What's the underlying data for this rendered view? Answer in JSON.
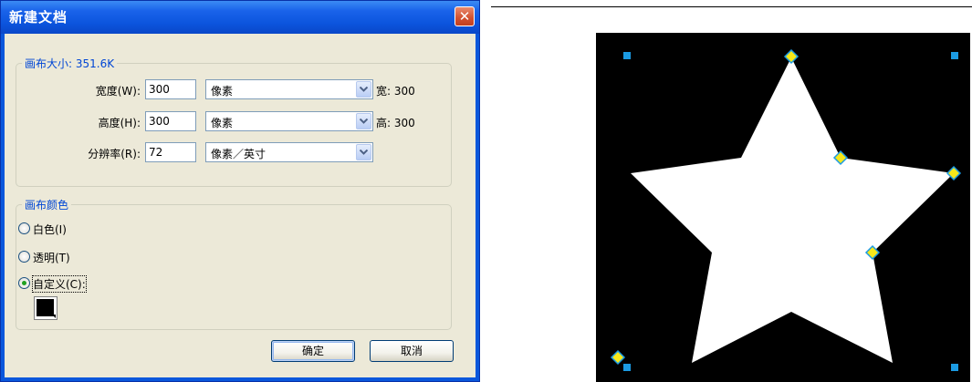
{
  "dialog": {
    "title": "新建文档",
    "close_glyph": "✕",
    "canvas_size": {
      "legend": "画布大小: 351.6K",
      "width": {
        "label": "宽度(W):",
        "value": "300",
        "unit": "像素",
        "result": "宽: 300"
      },
      "height": {
        "label": "高度(H):",
        "value": "300",
        "unit": "像素",
        "result": "高: 300"
      },
      "resolution": {
        "label": "分辨率(R):",
        "value": "72",
        "unit": "像素／英寸"
      }
    },
    "canvas_color": {
      "legend": "画布颜色",
      "options": [
        {
          "label": "白色(I)",
          "checked": false
        },
        {
          "label": "透明(T)",
          "checked": false
        },
        {
          "label": "自定义(C):",
          "checked": true
        }
      ],
      "custom_color": "#000000"
    },
    "ok_label": "确定",
    "cancel_label": "取消"
  },
  "colors": {
    "titlebar": "#0a57dc",
    "dialog_face": "#ece9d8",
    "group_legend": "#0046d5",
    "canvas_bg": "#000000",
    "star_fill": "#ffffff",
    "corner_handle": "#1b9be3",
    "point_handle": "#f6e81a"
  },
  "icons": {
    "close": "close-icon",
    "dropdown": "chevron-down-icon",
    "swatch_menu": "triangle-down-icon"
  }
}
